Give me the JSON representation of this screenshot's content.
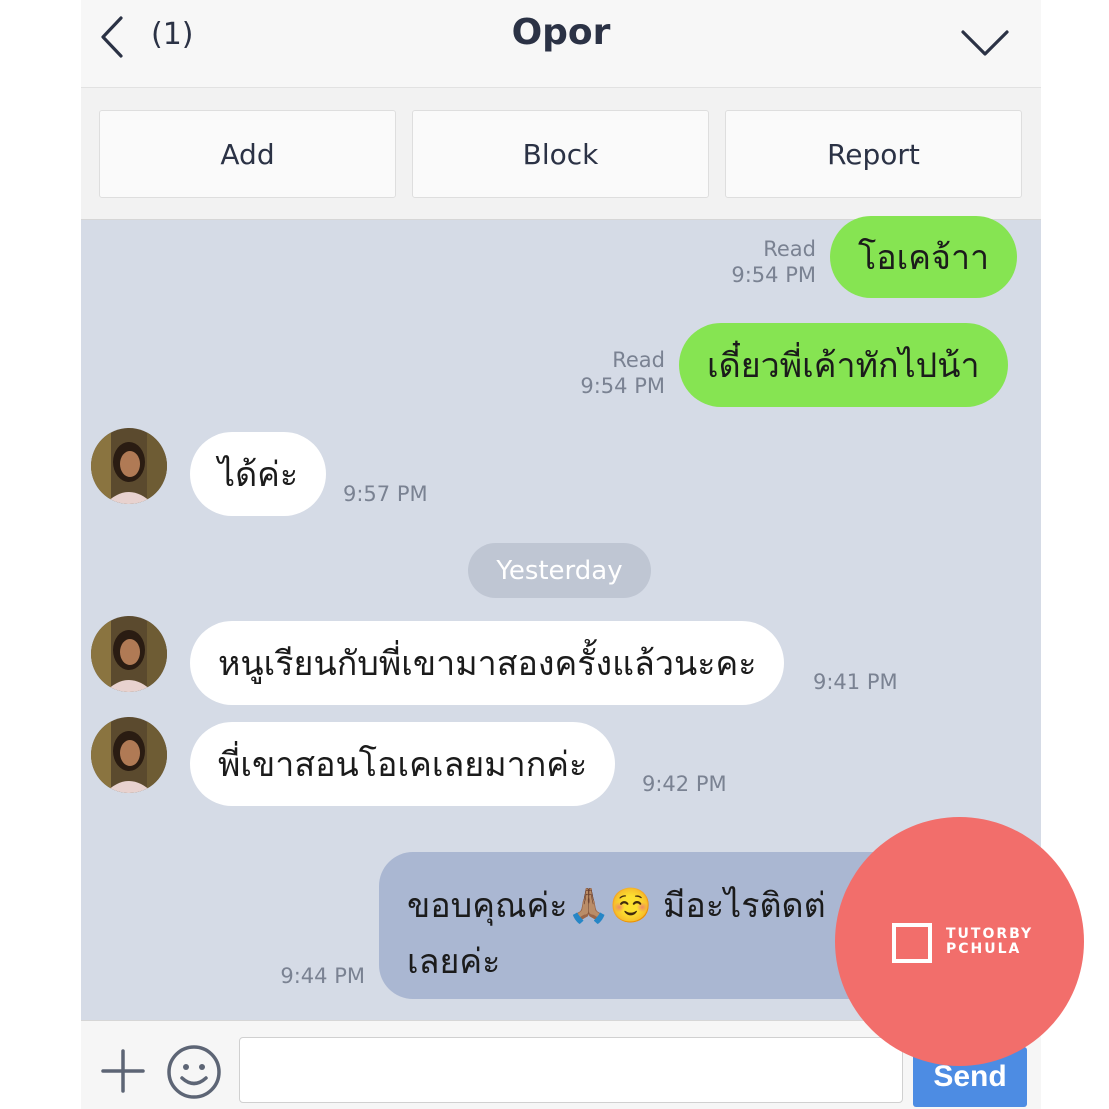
{
  "header": {
    "back_count": "(1)",
    "title": "Opor"
  },
  "actions": {
    "add": "Add",
    "block": "Block",
    "report": "Report"
  },
  "messages": [
    {
      "direction": "out",
      "text": "โอเคจ้าา",
      "status": "Read",
      "time": "9:54 PM"
    },
    {
      "direction": "out",
      "text": "เดี๋ยวพี่เค้าทักไปน้า",
      "status": "Read",
      "time": "9:54 PM"
    },
    {
      "direction": "in",
      "text": "ได้ค่ะ",
      "time": "9:57 PM"
    },
    {
      "direction": "in",
      "text": "หนูเรียนกับพี่เขามาสองครั้งแล้วนะคะ",
      "time": "9:41 PM"
    },
    {
      "direction": "in",
      "text": "พี่เขาสอนโอเคเลยมากค่ะ",
      "time": "9:42 PM"
    },
    {
      "direction": "out",
      "text_line1": "ขอบคุณค่ะ🙏🏽☺️ มีอะไรติดต่",
      "text_line2": "เลยค่ะ",
      "time": "9:44 PM"
    }
  ],
  "date_separator": "Yesterday",
  "input": {
    "placeholder": "",
    "send_label": "Send"
  },
  "watermark": {
    "line1": "TUTORBY",
    "line2": "PCHULA"
  },
  "colors": {
    "outgoing_bubble": "#86e452",
    "incoming_bubble": "#ffffff",
    "chat_background": "#d5dbe6",
    "send_button": "#4d8ce3",
    "watermark": "#f26e6b"
  }
}
